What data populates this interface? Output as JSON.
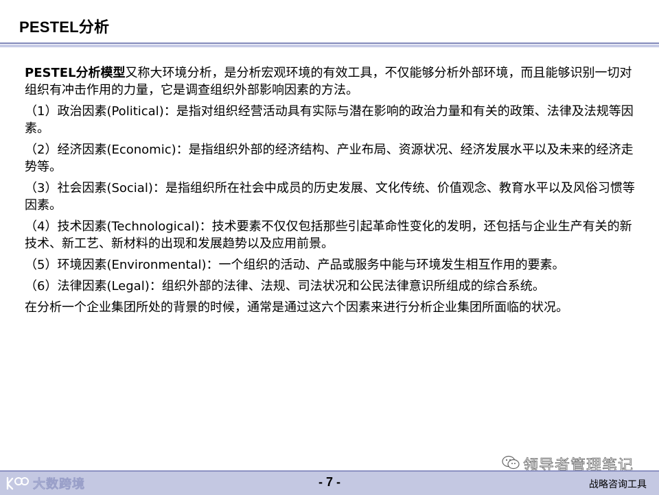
{
  "header": {
    "title": "PESTEL分析"
  },
  "content": {
    "intro_lead": "PESTEL分析模型",
    "intro_text": "又称大环境分析，是分析宏观环境的有效工具，不仅能够分析外部环境，而且能够识别一切对组织有冲击作用的力量，它是调查组织外部影响因素的方法。",
    "items": [
      "（1）政治因素(Political)：是指对组织经营活动具有实际与潜在影响的政治力量和有关的政策、法律及法规等因素。",
      "（2）经济因素(Economic)：是指组织外部的经济结构、产业布局、资源状况、经济发展水平以及未来的经济走势等。",
      "（3）社会因素(Social)：是指组织所在社会中成员的历史发展、文化传统、价值观念、教育水平以及风俗习惯等因素。",
      "（4）技术因素(Technological)：技术要素不仅仅包括那些引起革命性变化的发明，还包括与企业生产有关的新技术、新工艺、新材料的出现和发展趋势以及应用前景。",
      "（5）环境因素(Environmental)：一个组织的活动、产品或服务中能与环境发生相互作用的要素。",
      "（6）法律因素(Legal)：组织外部的法律、法规、司法状况和公民法律意识所组成的综合系统。"
    ],
    "conclusion": "在分析一个企业集团所处的背景的时候，通常是通过这六个因素来进行分析企业集团所面临的状况。"
  },
  "footer": {
    "logo_text": "大数跨境",
    "page_number": "- 7 -",
    "tool_label": "战略咨询工具"
  },
  "watermark": {
    "text": "领导者管理笔记"
  },
  "icons": {
    "logo": "k100-logo-icon",
    "watermark": "wechat-icon"
  },
  "colors": {
    "header_rule": "#7f86b8",
    "footer_bg": "#c4c8e2"
  }
}
